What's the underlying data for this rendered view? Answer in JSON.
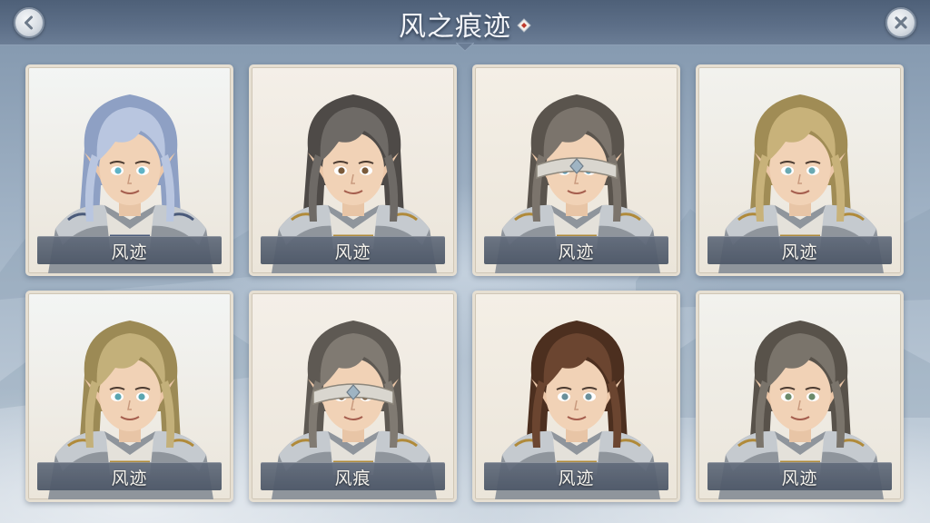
{
  "header": {
    "title": "风之痕迹",
    "back_icon": "chevron-left-icon",
    "close_icon": "close-icon",
    "info_icon": "diamond-info-icon",
    "accent_color": "#c0392b"
  },
  "cards": [
    {
      "name": "风迹",
      "hair_color": "#b9c6e0",
      "hair_shade": "#8ea0c4",
      "eye_color": "#5fb3c6",
      "headband": false,
      "armor_accent": "#4a5a7a"
    },
    {
      "name": "风迹",
      "hair_color": "#6e6a66",
      "hair_shade": "#4e4a47",
      "eye_color": "#7a5a3a",
      "headband": false,
      "armor_accent": "#b08a3a"
    },
    {
      "name": "风迹",
      "hair_color": "#7b746c",
      "hair_shade": "#5a544d",
      "eye_color": "#5a9bb5",
      "headband": true,
      "armor_accent": "#b08a3a"
    },
    {
      "name": "风迹",
      "hair_color": "#c8b27a",
      "hair_shade": "#a08c55",
      "eye_color": "#6aa9b2",
      "headband": false,
      "armor_accent": "#b08a3a"
    },
    {
      "name": "风迹",
      "hair_color": "#c3b07a",
      "hair_shade": "#9c8a55",
      "eye_color": "#5aa5b0",
      "headband": false,
      "armor_accent": "#b08a3a"
    },
    {
      "name": "风痕",
      "hair_color": "#807a72",
      "hair_shade": "#5e5953",
      "eye_color": "#7a5a3a",
      "headband": true,
      "armor_accent": "#b08a3a"
    },
    {
      "name": "风迹",
      "hair_color": "#6b4530",
      "hair_shade": "#4c2f1f",
      "eye_color": "#6a8f9a",
      "headband": false,
      "armor_accent": "#b08a3a"
    },
    {
      "name": "风迹",
      "hair_color": "#7a746b",
      "hair_shade": "#58524a",
      "eye_color": "#6b8a6a",
      "headband": false,
      "armor_accent": "#b08a3a"
    }
  ]
}
